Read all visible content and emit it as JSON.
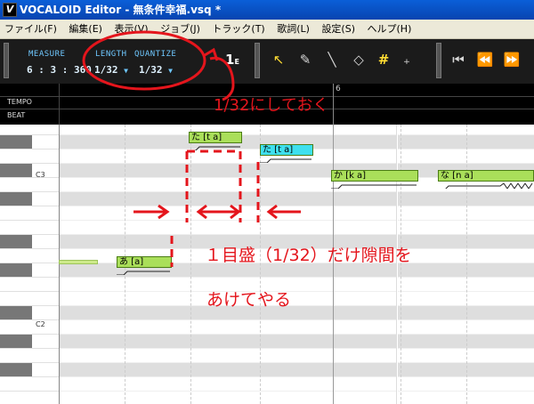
{
  "window": {
    "title": "VOCALOID Editor - 無条件幸福.vsq *",
    "app_icon": "vocaloid-logo"
  },
  "menu": [
    "ファイル(F)",
    "編集(E)",
    "表示(V)",
    "ジョブ(J)",
    "トラック(T)",
    "歌詞(L)",
    "設定(S)",
    "ヘルプ(H)"
  ],
  "toolbar": {
    "measure_label": "MEASURE",
    "measure_value": "6 : 3 : 360",
    "length_label": "LENGTH",
    "length_value": "1/32",
    "quantize_label": "QUANTIZE",
    "quantize_value": "1/32",
    "tools": [
      "select-arrow-icon",
      "pencil-icon",
      "line-icon",
      "eraser-icon",
      "grid-icon",
      "vibrato-icon"
    ],
    "transport": [
      "go-start-icon",
      "rewind-icon",
      "fast-forward-icon"
    ]
  },
  "ruler": {
    "measure_number": "6",
    "rows": [
      "TEMPO",
      "BEAT"
    ]
  },
  "piano": {
    "labels": [
      "C3",
      "C2"
    ]
  },
  "notes": [
    {
      "lyric": "た [t a]",
      "color": "#aadf5a"
    },
    {
      "lyric": "た [t a]",
      "color": "#3ee0ee"
    },
    {
      "lyric": "か [k a]",
      "color": "#aadf5a"
    },
    {
      "lyric": "な [n a]",
      "color": "#aadf5a"
    },
    {
      "lyric": "あ [a]",
      "color": "#aadf5a"
    }
  ],
  "annotations": {
    "toolbar_note": "1/32にしておく",
    "gap_note": "１目盛（1/32）だけ隙間を",
    "gap_note2": "あけてやる",
    "color": "#e4151c"
  }
}
